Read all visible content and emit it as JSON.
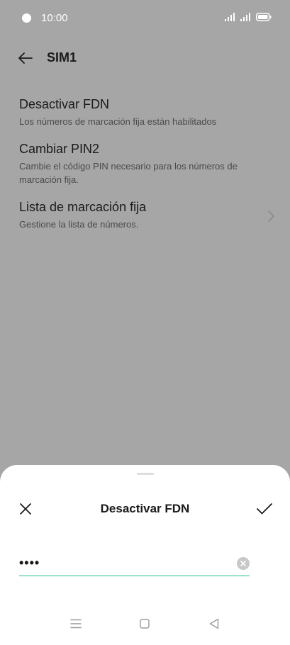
{
  "status_bar": {
    "time": "10:00"
  },
  "header": {
    "title": "SIM1"
  },
  "settings": {
    "items": [
      {
        "title": "Desactivar FDN",
        "subtitle": "Los números de marcación fija están habilitados"
      },
      {
        "title": "Cambiar PIN2",
        "subtitle": "Cambie el código PIN necesario para los números de marcación fija."
      },
      {
        "title": "Lista de marcación fija",
        "subtitle": "Gestione la lista de números."
      }
    ]
  },
  "dialog": {
    "title": "Desactivar FDN",
    "pin_value": "••••"
  },
  "colors": {
    "accent": "#29b891",
    "scrim": "#a6a6a6"
  },
  "icons": {
    "back": "arrow-left-icon",
    "chevron": "chevron-right-icon",
    "close": "close-icon",
    "confirm": "check-icon",
    "clear": "clear-input-icon",
    "nav_menu": "menu-icon",
    "nav_home": "home-icon",
    "nav_back": "back-triangle-icon"
  }
}
